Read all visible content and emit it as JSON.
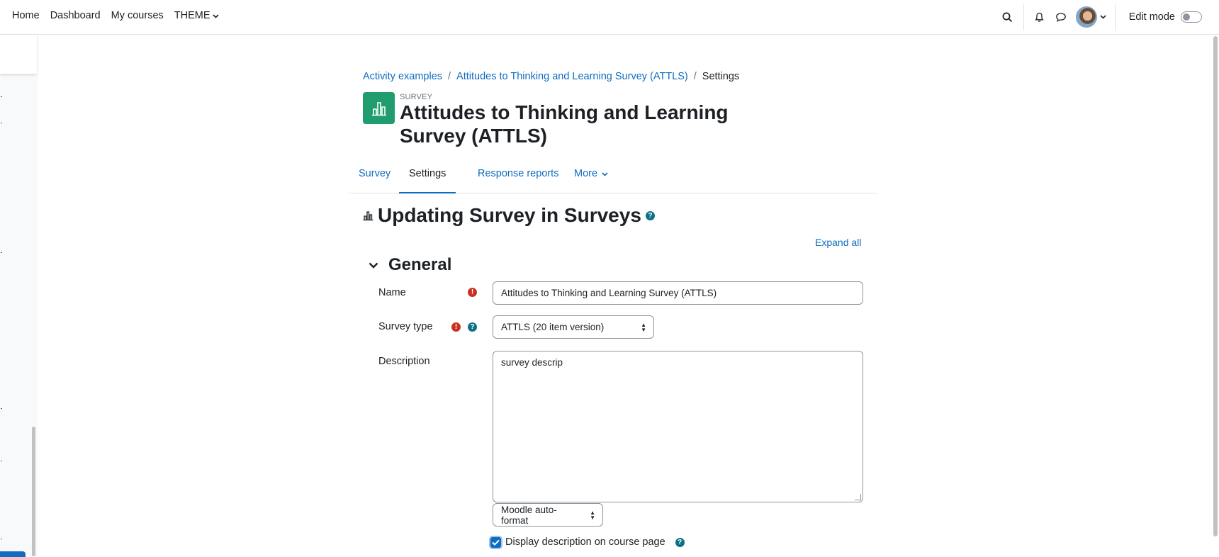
{
  "navbar": {
    "links": [
      "Home",
      "Dashboard",
      "My courses"
    ],
    "theme_label": "THEME",
    "edit_mode_label": "Edit mode"
  },
  "breadcrumb": [
    "Activity examples",
    "Attitudes to Thinking and Learning Survey (ATTLS)",
    "Settings"
  ],
  "header": {
    "module_type": "SURVEY",
    "title": "Attitudes to Thinking and Learning Survey (ATTLS)"
  },
  "tabs": [
    {
      "label": "Survey",
      "active": false
    },
    {
      "label": "Settings",
      "active": true
    },
    {
      "label": "Response reports",
      "active": false
    },
    {
      "label": "More",
      "active": false
    }
  ],
  "form": {
    "title": "Updating Survey in Surveys",
    "expand_all": "Expand all",
    "section_title": "General",
    "name_label": "Name",
    "name_value": "Attitudes to Thinking and Learning Survey (ATTLS)",
    "survey_type_label": "Survey type",
    "survey_type_value": "ATTLS (20 item version)",
    "description_label": "Description",
    "description_value": "survey descrip",
    "format_value": "Moodle auto-format",
    "display_description_label": "Display description on course page",
    "display_description_checked": true
  },
  "colors": {
    "link": "#0f6cbf",
    "activity_icon_bg": "#1f9d6e",
    "required": "#ca3120"
  }
}
